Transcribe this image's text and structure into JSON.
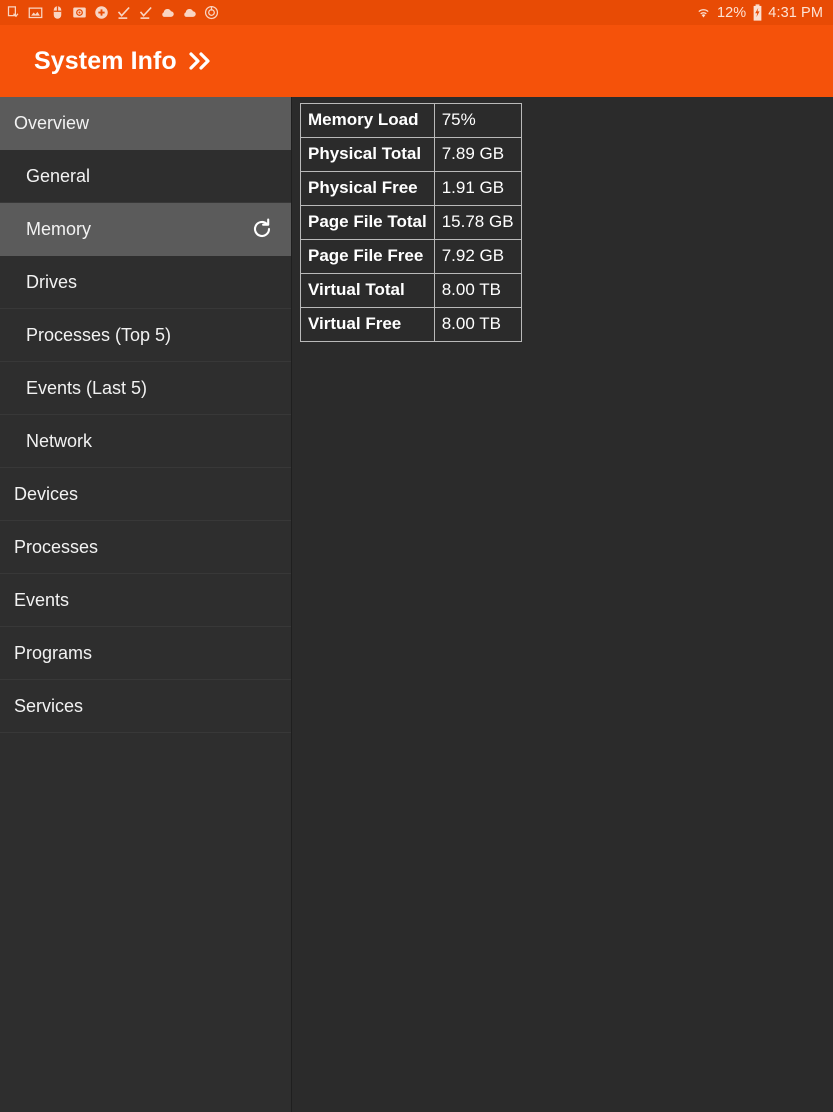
{
  "status_bar": {
    "notification_icons": [
      "screenshot-icon",
      "image-icon",
      "mouse-icon",
      "photo-tag-icon",
      "add-circle-icon",
      "check-download-icon",
      "check-download-icon-2",
      "cloud-icon",
      "cloud-icon-2",
      "power-timer-icon"
    ],
    "wifi_icon": "wifi-icon",
    "battery_percent": "12%",
    "battery_icon": "battery-charging-icon",
    "clock": "4:31 PM",
    "background_color": "#e84b05",
    "text_color": "#fde3d5"
  },
  "title_bar": {
    "title": "System Info",
    "chevron_icon": "double-chevron-right-icon",
    "background_color": "#f5520a",
    "text_color": "#ffffff"
  },
  "sidebar": {
    "selected_color": "#5b5b5b",
    "background_color": "#2e2e2e",
    "items": [
      {
        "label": "Overview",
        "level": 0,
        "selected": true,
        "action_icon": null
      },
      {
        "label": "General",
        "level": 1,
        "selected": false,
        "action_icon": null
      },
      {
        "label": "Memory",
        "level": 1,
        "selected": true,
        "action_icon": "refresh-icon"
      },
      {
        "label": "Drives",
        "level": 1,
        "selected": false,
        "action_icon": null
      },
      {
        "label": "Processes (Top 5)",
        "level": 1,
        "selected": false,
        "action_icon": null
      },
      {
        "label": "Events (Last 5)",
        "level": 1,
        "selected": false,
        "action_icon": null
      },
      {
        "label": "Network",
        "level": 1,
        "selected": false,
        "action_icon": null
      },
      {
        "label": "Devices",
        "level": 0,
        "selected": false,
        "action_icon": null
      },
      {
        "label": "Processes",
        "level": 0,
        "selected": false,
        "action_icon": null
      },
      {
        "label": "Events",
        "level": 0,
        "selected": false,
        "action_icon": null
      },
      {
        "label": "Programs",
        "level": 0,
        "selected": false,
        "action_icon": null
      },
      {
        "label": "Services",
        "level": 0,
        "selected": false,
        "action_icon": null
      }
    ]
  },
  "content": {
    "memory_table": {
      "rows": [
        {
          "key": "Memory Load",
          "value": "75%"
        },
        {
          "key": "Physical Total",
          "value": "7.89 GB"
        },
        {
          "key": "Physical Free",
          "value": "1.91 GB"
        },
        {
          "key": "Page File Total",
          "value": "15.78 GB"
        },
        {
          "key": "Page File Free",
          "value": "7.92 GB"
        },
        {
          "key": "Virtual Total",
          "value": "8.00 TB"
        },
        {
          "key": "Virtual Free",
          "value": "8.00 TB"
        }
      ]
    }
  }
}
